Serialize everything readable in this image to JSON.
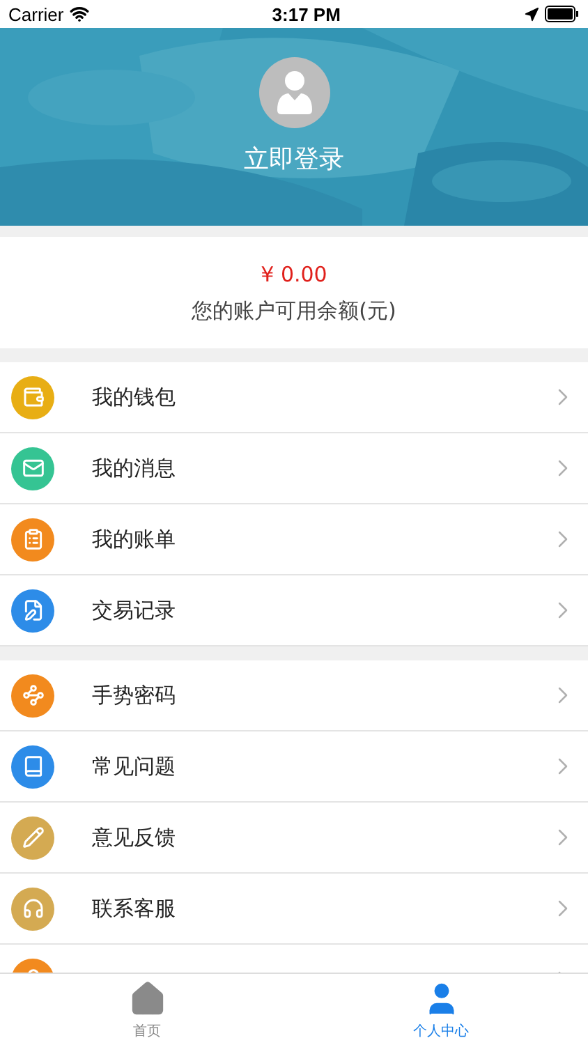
{
  "status_bar": {
    "carrier": "Carrier",
    "time": "3:17 PM"
  },
  "profile": {
    "login_label": "立即登录"
  },
  "balance": {
    "amount": "¥ 0.00",
    "caption": "您的账户可用余额(元)"
  },
  "menu_groups": [
    {
      "items": [
        {
          "kind": "wallet",
          "label": "我的钱包",
          "color": "#e8ae14"
        },
        {
          "kind": "message",
          "label": "我的消息",
          "color": "#35c493"
        },
        {
          "kind": "bill",
          "label": "我的账单",
          "color": "#f28a1e"
        },
        {
          "kind": "record",
          "label": "交易记录",
          "color": "#2d8ce8"
        }
      ]
    },
    {
      "items": [
        {
          "kind": "gesture",
          "label": "手势密码",
          "color": "#f28a1e"
        },
        {
          "kind": "faq",
          "label": "常见问题",
          "color": "#2d8ce8"
        },
        {
          "kind": "feedback",
          "label": "意见反馈",
          "color": "#d4aa52"
        },
        {
          "kind": "service",
          "label": "联系客服",
          "color": "#d4aa52"
        },
        {
          "kind": "security",
          "color": "#f28a1e"
        }
      ]
    }
  ],
  "tab_bar": [
    {
      "kind": "home",
      "label": "首页",
      "selected": false
    },
    {
      "kind": "person",
      "label": "个人中心",
      "selected": true
    }
  ]
}
